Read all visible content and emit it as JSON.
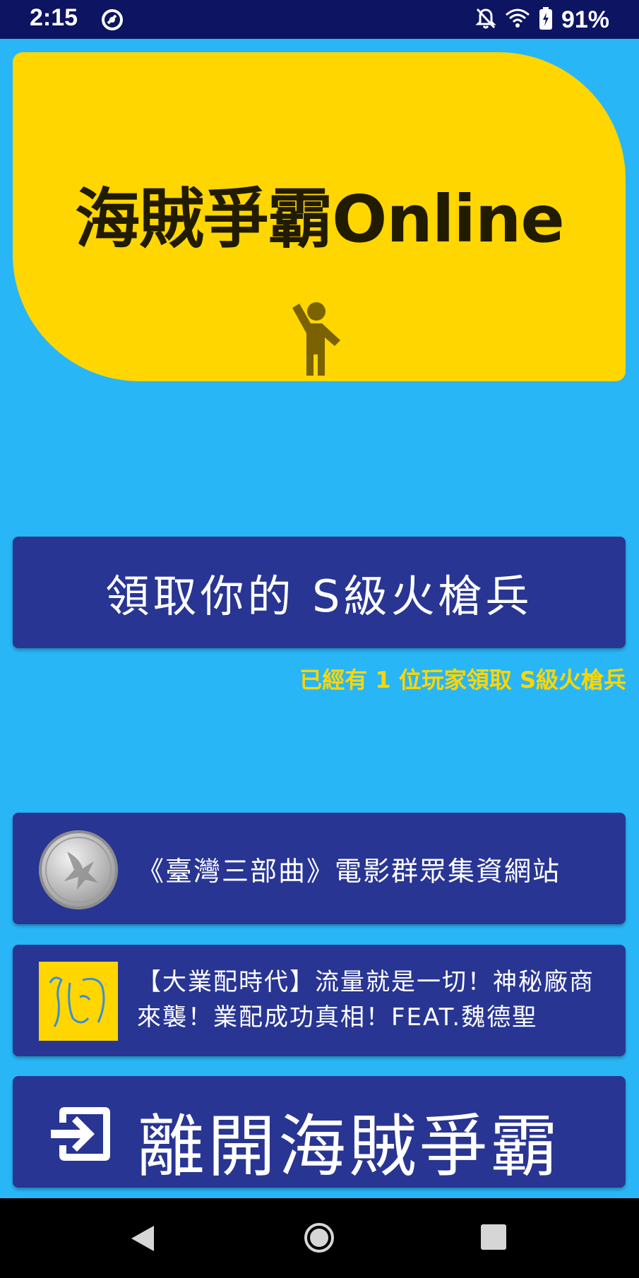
{
  "status_bar": {
    "time": "2:15",
    "battery": "91%",
    "icons": [
      "app-notification-icon",
      "bell-off-icon",
      "wifi-icon",
      "battery-charging-icon"
    ]
  },
  "banner": {
    "title": "海賊爭霸Online",
    "icon": "waving-person-icon",
    "color": "#ffd600",
    "text_color": "#211b00"
  },
  "claim": {
    "button_label": "領取你的 S級火槍兵",
    "status_text": "已經有 1 位玩家領取 S級火槍兵"
  },
  "links": [
    {
      "label": "《臺灣三部曲》電影群眾集資網站",
      "thumbnail": "silver-coin-image"
    },
    {
      "label": "【大業配時代】流量就是一切！神秘廠商來襲！業配成功真相！FEAT.魏德聖",
      "thumbnail": "yellow-logo-image"
    }
  ],
  "exit": {
    "label": "離開海賊爭霸",
    "icon": "exit-to-app-icon"
  },
  "nav_bar": {
    "icons": [
      "back-icon",
      "home-icon",
      "recents-icon"
    ]
  },
  "colors": {
    "background": "#29b6f6",
    "button": "#283593",
    "accent": "#ffd600",
    "status_bar": "#0d1461"
  }
}
